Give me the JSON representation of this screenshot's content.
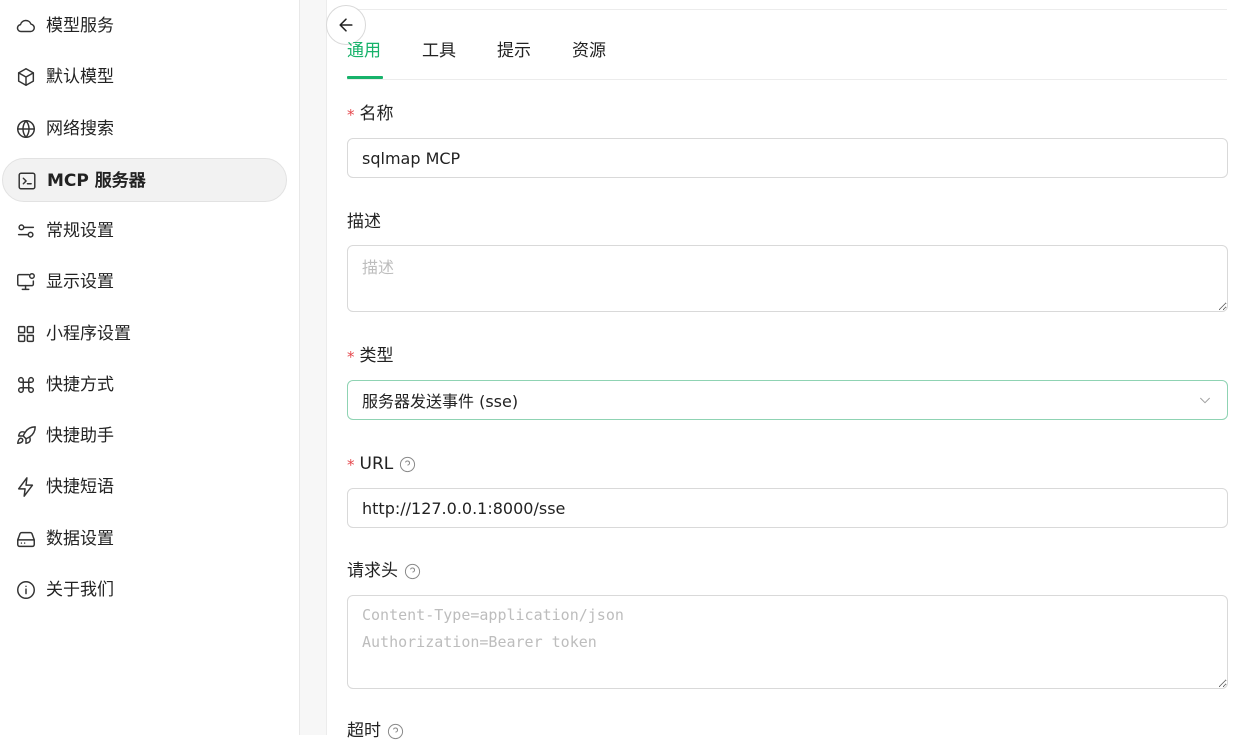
{
  "sidebar": {
    "items": [
      {
        "label": "模型服务",
        "icon": "cloud-icon"
      },
      {
        "label": "默认模型",
        "icon": "cube-icon"
      },
      {
        "label": "网络搜索",
        "icon": "globe-icon"
      },
      {
        "label": "MCP 服务器",
        "icon": "terminal-icon",
        "active": true
      },
      {
        "label": "常规设置",
        "icon": "settings-sliders-icon"
      },
      {
        "label": "显示设置",
        "icon": "monitor-icon"
      },
      {
        "label": "小程序设置",
        "icon": "grid-icon"
      },
      {
        "label": "快捷方式",
        "icon": "command-icon"
      },
      {
        "label": "快捷助手",
        "icon": "rocket-icon"
      },
      {
        "label": "快捷短语",
        "icon": "zap-icon"
      },
      {
        "label": "数据设置",
        "icon": "hard-drive-icon"
      },
      {
        "label": "关于我们",
        "icon": "info-icon"
      }
    ]
  },
  "tabs": [
    {
      "label": "通用",
      "active": true
    },
    {
      "label": "工具"
    },
    {
      "label": "提示"
    },
    {
      "label": "资源"
    }
  ],
  "form": {
    "name": {
      "label": "名称",
      "value": "sqlmap MCP"
    },
    "description": {
      "label": "描述",
      "placeholder": "描述"
    },
    "type": {
      "label": "类型",
      "value": "服务器发送事件 (sse)"
    },
    "url": {
      "label": "URL",
      "value": "http://127.0.0.1:8000/sse"
    },
    "headers": {
      "label": "请求头",
      "placeholder": "Content-Type=application/json\nAuthorization=Bearer token"
    },
    "timeout": {
      "label": "超时"
    }
  },
  "colors": {
    "accent": "#17b26a",
    "required": "#e5484d"
  }
}
